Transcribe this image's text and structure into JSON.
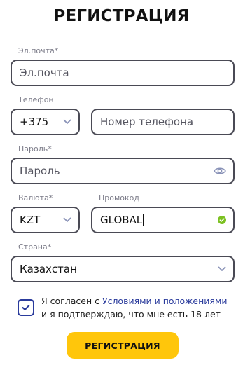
{
  "title": "РЕГИСТРАЦИЯ",
  "email": {
    "label": "Эл.почта",
    "required_mark": "*",
    "placeholder": "Эл.почта"
  },
  "phone": {
    "label": "Телефон",
    "country_code": "+375",
    "placeholder": "Номер телефона"
  },
  "password": {
    "label": "Пароль",
    "required_mark": "*",
    "placeholder": "Пароль",
    "toggle_icon": "eye-icon"
  },
  "currency": {
    "label": "Валюта",
    "required_mark": "*",
    "value": "KZT"
  },
  "promocode": {
    "label": "Промокод",
    "value": "GLOBAL",
    "status": "valid",
    "status_color": "#7cc121"
  },
  "country": {
    "label": "Страна",
    "required_mark": "*",
    "value": "Казахстан"
  },
  "consent": {
    "checked": true,
    "text_before": "Я согласен с ",
    "link_text": "Условиями и положениями",
    "text_after": "и я подтверждаю, что мне есть 18 лет"
  },
  "submit_label": "РЕГИСТРАЦИЯ",
  "colors": {
    "accent_button": "#ffc60b",
    "link": "#2a3b9c",
    "border": "#4a4a55",
    "success": "#7cc121"
  }
}
